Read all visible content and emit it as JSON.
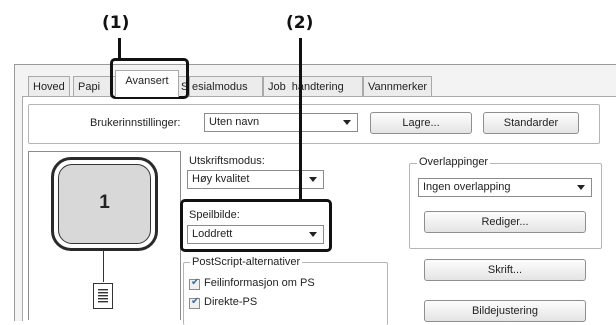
{
  "callouts": [
    "(1)",
    "(2)"
  ],
  "tabs": [
    "Hoved",
    "Papi",
    "Avansert",
    "S",
    "esialmodus",
    "Job",
    "håndtering",
    "Vannmerker"
  ],
  "user_settings": {
    "label": "Brukerinnstillinger:",
    "value": "Uten navn",
    "save_button": "Lagre...",
    "defaults_button": "Standarder"
  },
  "preview": {
    "page_number": "1"
  },
  "print_mode": {
    "label": "Utskriftsmodus:",
    "value": "Høy kvalitet"
  },
  "mirror": {
    "label": "Speilbilde:",
    "value": "Loddrett"
  },
  "postscript": {
    "label": "PostScript-alternativer",
    "options": [
      {
        "label": "Feilinformasjon om PS",
        "checked": true
      },
      {
        "label": "Direkte-PS",
        "checked": true
      }
    ]
  },
  "overlays": {
    "label": "Overlappinger",
    "value": "Ingen overlapping",
    "edit_button": "Rediger..."
  },
  "font_button": "Skrift...",
  "image_adjust_button": "Bildejustering"
}
